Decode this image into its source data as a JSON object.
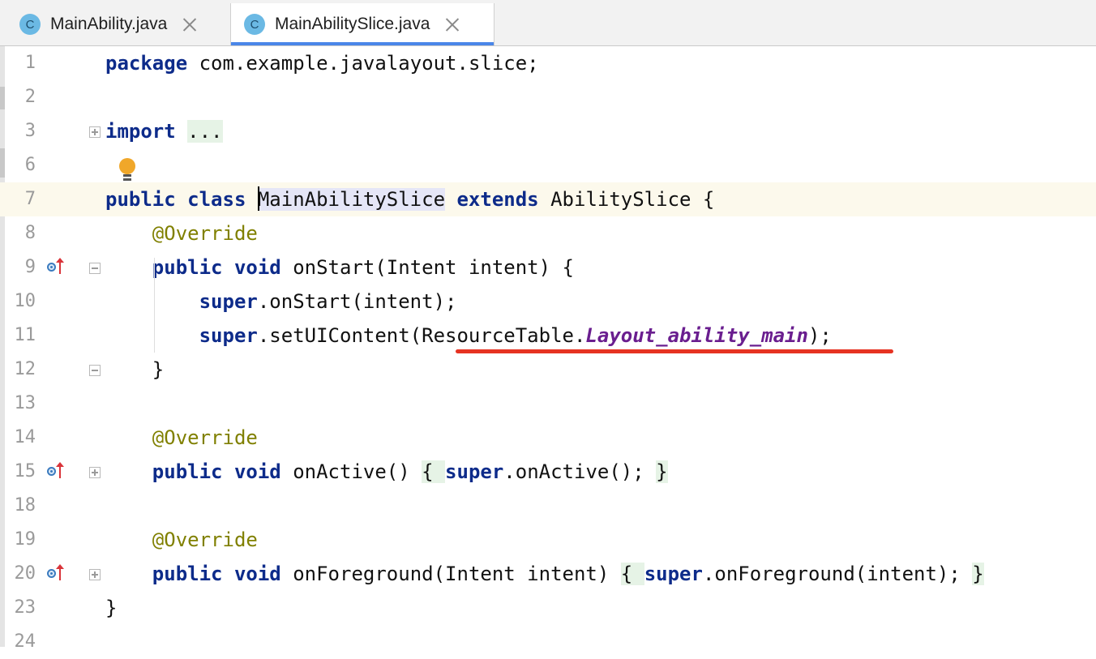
{
  "tabs": [
    {
      "label": "MainAbility.java",
      "icon": "class-icon",
      "icon_letter": "C",
      "active": false
    },
    {
      "label": "MainAbilitySlice.java",
      "icon": "class-icon",
      "icon_letter": "C",
      "active": true
    }
  ],
  "editor": {
    "current_line": "7",
    "lines": [
      {
        "num": "1",
        "code": [
          [
            "kw",
            "package"
          ],
          [
            "t",
            " com.example.javalayout.slice;"
          ]
        ]
      },
      {
        "num": "2",
        "code": []
      },
      {
        "num": "3",
        "code": [
          [
            "kw",
            "import"
          ],
          [
            "t",
            " "
          ],
          [
            "fold",
            "..."
          ]
        ]
      },
      {
        "num": "6",
        "code": []
      },
      {
        "num": "7",
        "code": [
          [
            "kw",
            "public class"
          ],
          [
            "t",
            " "
          ],
          [
            "caret",
            ""
          ],
          [
            "hl",
            "MainAbilitySlice"
          ],
          [
            "t",
            " "
          ],
          [
            "kw",
            "extends"
          ],
          [
            "t",
            " AbilitySlice {"
          ]
        ]
      },
      {
        "num": "8",
        "code": [
          [
            "t",
            "    "
          ],
          [
            "ann",
            "@Override"
          ]
        ]
      },
      {
        "num": "9",
        "code": [
          [
            "t",
            "    "
          ],
          [
            "kw",
            "public void"
          ],
          [
            "t",
            " onStart(Intent intent) {"
          ]
        ]
      },
      {
        "num": "10",
        "code": [
          [
            "t",
            "        "
          ],
          [
            "kw",
            "super"
          ],
          [
            "t",
            ".onStart(intent);"
          ]
        ]
      },
      {
        "num": "11",
        "code": [
          [
            "t",
            "        "
          ],
          [
            "kw",
            "super"
          ],
          [
            "t",
            ".setUIContent(ResourceTable."
          ],
          [
            "fld",
            "Layout_ability_main"
          ],
          [
            "t",
            ");"
          ]
        ]
      },
      {
        "num": "12",
        "code": [
          [
            "t",
            "    }"
          ]
        ]
      },
      {
        "num": "13",
        "code": []
      },
      {
        "num": "14",
        "code": [
          [
            "t",
            "    "
          ],
          [
            "ann",
            "@Override"
          ]
        ]
      },
      {
        "num": "15",
        "code": [
          [
            "t",
            "    "
          ],
          [
            "kw",
            "public void"
          ],
          [
            "t",
            " onActive() "
          ],
          [
            "fold",
            "{ "
          ],
          [
            "kw",
            "super"
          ],
          [
            "t",
            ".onActive(); "
          ],
          [
            "fold",
            "}"
          ]
        ]
      },
      {
        "num": "18",
        "code": []
      },
      {
        "num": "19",
        "code": [
          [
            "t",
            "    "
          ],
          [
            "ann",
            "@Override"
          ]
        ]
      },
      {
        "num": "20",
        "code": [
          [
            "t",
            "    "
          ],
          [
            "kw",
            "public void"
          ],
          [
            "t",
            " onForeground(Intent intent) "
          ],
          [
            "fold",
            "{ "
          ],
          [
            "kw",
            "super"
          ],
          [
            "t",
            ".onForeground(intent); "
          ],
          [
            "fold",
            "}"
          ]
        ]
      },
      {
        "num": "23",
        "code": [
          [
            "t",
            "}"
          ]
        ]
      },
      {
        "num": "24",
        "code": []
      }
    ]
  },
  "colors": {
    "keyword": "#0d2b8a",
    "annotation": "#808000",
    "static_field": "#6a1e8f",
    "current_line_bg": "#fcf9ec",
    "underline": "#e63322",
    "tab_active_indicator": "#4a86e8"
  }
}
